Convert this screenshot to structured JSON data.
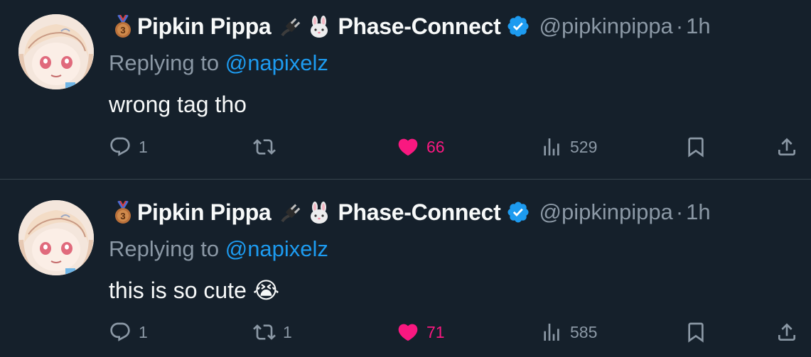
{
  "tweets": [
    {
      "author": {
        "name": "Pipkin Pippa",
        "group": "Phase-Connect",
        "handle": "@pipkinpippa",
        "verified": true
      },
      "time": "1h",
      "replying_label": "Replying to",
      "replying_to": "@napixelz",
      "text": "wrong tag tho",
      "text_emoji": "",
      "actions": {
        "replies": "1",
        "retweets": "",
        "likes": "66",
        "views": "529"
      },
      "liked": true
    },
    {
      "author": {
        "name": "Pipkin Pippa",
        "group": "Phase-Connect",
        "handle": "@pipkinpippa",
        "verified": true
      },
      "time": "1h",
      "replying_label": "Replying to",
      "replying_to": "@napixelz",
      "text": "this is so cute",
      "text_emoji": "😭",
      "actions": {
        "replies": "1",
        "retweets": "1",
        "likes": "71",
        "views": "585"
      },
      "liked": true
    }
  ],
  "icons": {
    "medal": "bronze-medal-icon",
    "plug": "electric-plug-icon",
    "rabbit": "rabbit-face-icon",
    "verified": "verified-badge-icon"
  },
  "colors": {
    "background": "#15202b",
    "text": "#f7f9f9",
    "secondary": "#8b98a5",
    "accent": "#1d9bf0",
    "like": "#f91880"
  },
  "separator": "·"
}
